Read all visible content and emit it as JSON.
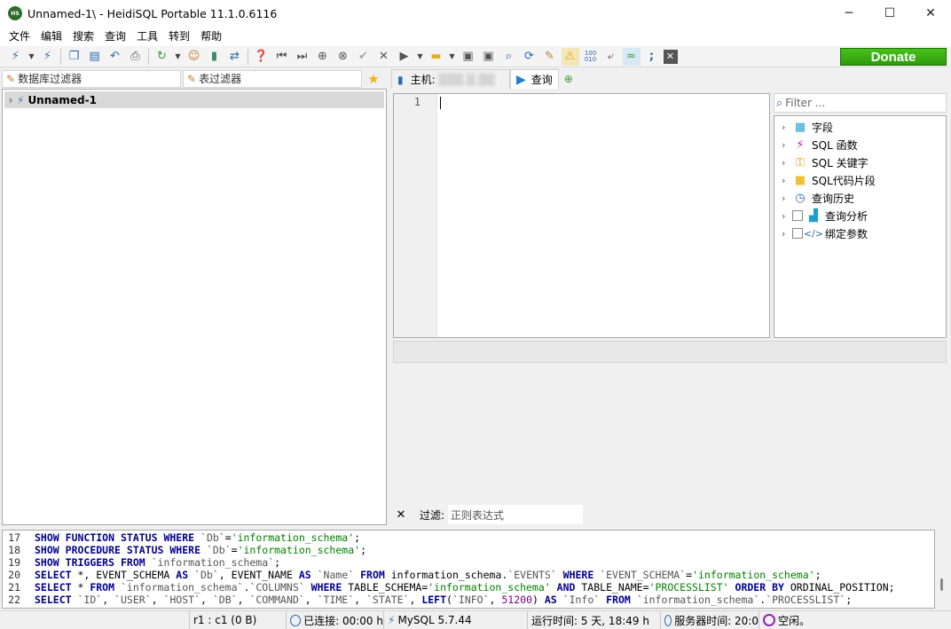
{
  "window": {
    "title": "Unnamed-1\\ - HeidiSQL Portable 11.1.0.6116",
    "app_icon_text": "HS"
  },
  "menu": [
    "文件",
    "编辑",
    "搜索",
    "查询",
    "工具",
    "转到",
    "帮助"
  ],
  "donate_label": "Donate",
  "left_filters": {
    "db_filter_placeholder": "数据库过滤器",
    "table_filter_placeholder": "表过滤器"
  },
  "tree": {
    "root_label": "Unnamed-1"
  },
  "tabs": {
    "host_label": "主机:",
    "host_value_blurred": "▒▒▒.▒.▒▒",
    "query_label": "查询"
  },
  "editor": {
    "line_number": "1"
  },
  "helper": {
    "filter_placeholder": "Filter ...",
    "items": [
      {
        "label": "字段",
        "icon": "table-grid-icon"
      },
      {
        "label": "SQL 函数",
        "icon": "lightning-icon"
      },
      {
        "label": "SQL 关键字",
        "icon": "key-icon"
      },
      {
        "label": "SQL代码片段",
        "icon": "folder-icon"
      },
      {
        "label": "查询历史",
        "icon": "clock-icon"
      },
      {
        "label": "查询分析",
        "icon": "bar-chart-icon"
      },
      {
        "label": "绑定参数",
        "icon": "code-tag-icon"
      }
    ]
  },
  "result_filter": {
    "label": "过滤:",
    "placeholder": "正则表达式"
  },
  "log": [
    {
      "n": "17",
      "text": "SHOW FUNCTION STATUS WHERE `Db`='information_schema';"
    },
    {
      "n": "18",
      "text": "SHOW PROCEDURE STATUS WHERE `Db`='information_schema';"
    },
    {
      "n": "19",
      "text": "SHOW TRIGGERS FROM `information_schema`;"
    },
    {
      "n": "20",
      "text": "SELECT *, EVENT_SCHEMA AS `Db`, EVENT_NAME AS `Name` FROM information_schema.`EVENTS` WHERE `EVENT_SCHEMA`='information_schema';"
    },
    {
      "n": "21",
      "text": "SELECT * FROM `information_schema`.`COLUMNS` WHERE TABLE_SCHEMA='information_schema' AND TABLE_NAME='PROCESSLIST' ORDER BY ORDINAL_POSITION;"
    },
    {
      "n": "22",
      "text": "SELECT `ID`, `USER`, `HOST`, `DB`, `COMMAND`, `TIME`, `STATE`, LEFT(`INFO`, 51200) AS `Info` FROM `information_schema`.`PROCESSLIST`;"
    }
  ],
  "status": {
    "cursor": "r1 : c1 (0 B)",
    "connected": "已连接: 00:00 h",
    "server": "MySQL 5.7.44",
    "uptime": "运行时间: 5 天, 18:49 h",
    "server_time": "服务器时间: 20:0",
    "idle": "空闲。"
  }
}
